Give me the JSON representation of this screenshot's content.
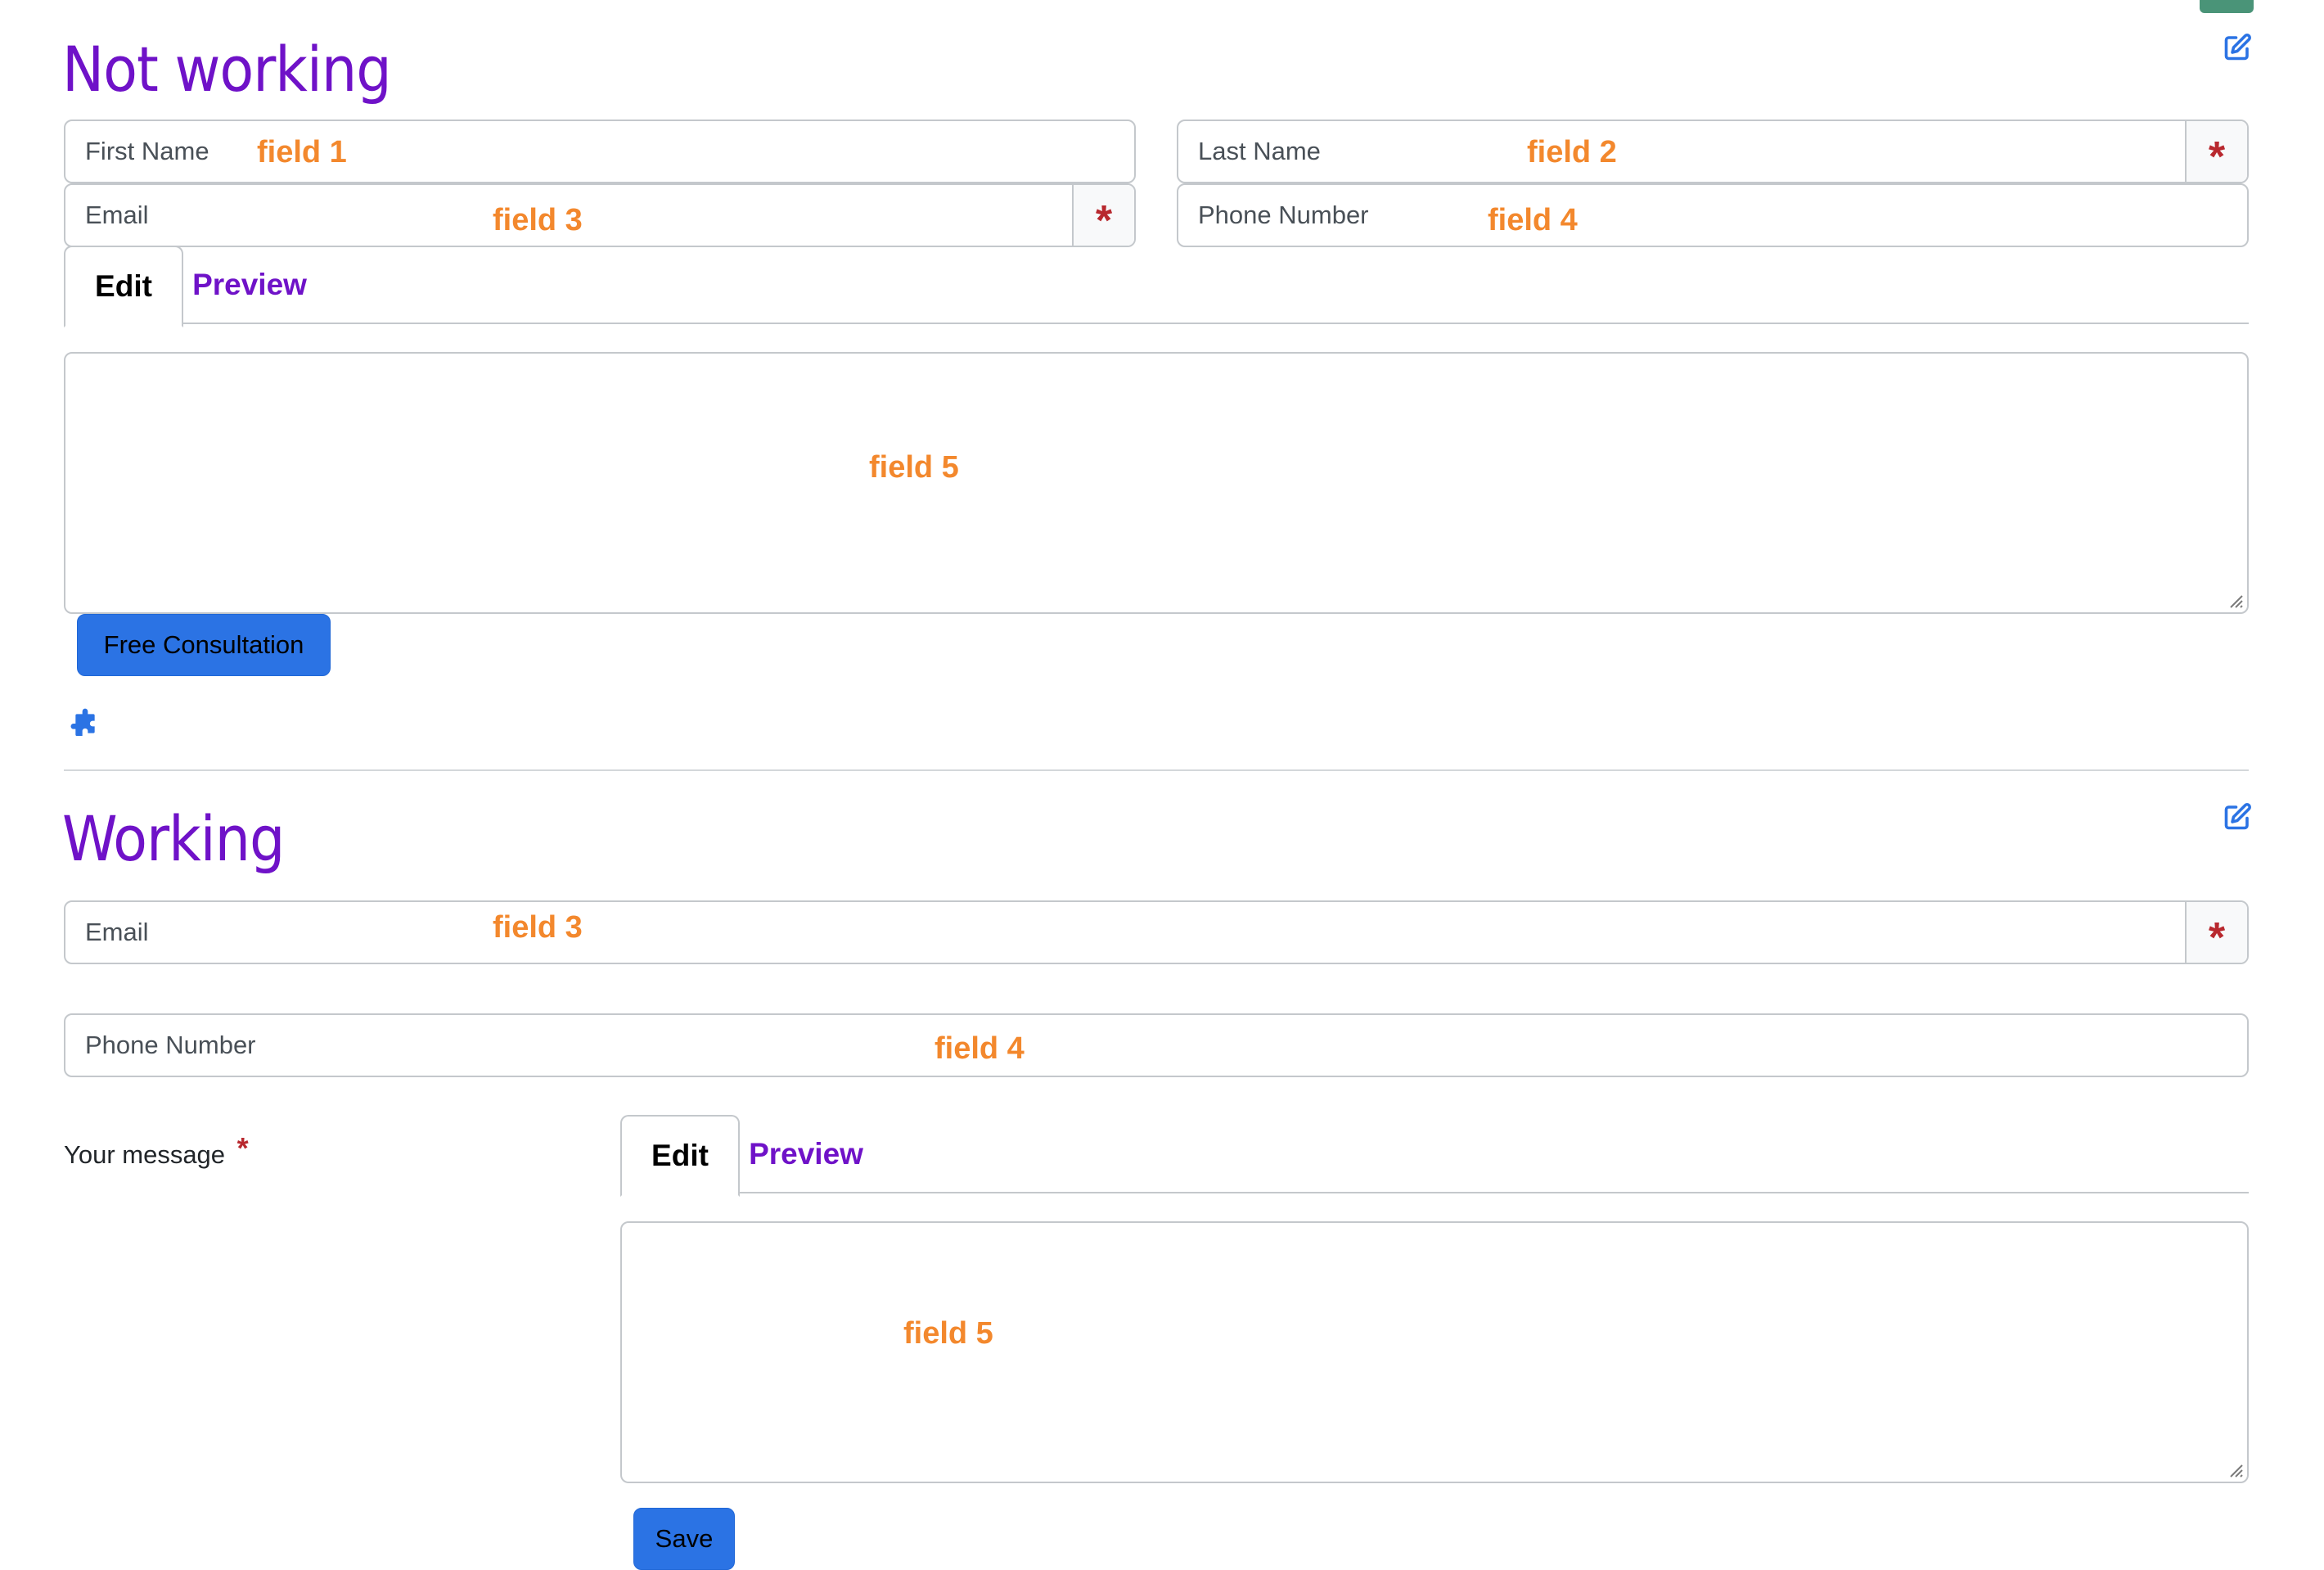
{
  "colors": {
    "heading": "#6f12c8",
    "annotation": "#f3882d",
    "button": "#2b73e4",
    "required": "#b8282e",
    "link": "#2b73e4",
    "corner_block": "#4a9478"
  },
  "icons": {
    "edit": "edit-icon",
    "puzzle": "puzzle-icon",
    "required": "asterisk-icon",
    "resize": "resize-grip-icon"
  },
  "section_not_working": {
    "title": "Not working",
    "first_name": {
      "placeholder": "First Name",
      "annotation": "field 1"
    },
    "last_name": {
      "placeholder": "Last Name",
      "annotation": "field 2",
      "required_mark": "*"
    },
    "email": {
      "placeholder": "Email",
      "annotation": "field 3",
      "required_mark": "*"
    },
    "phone": {
      "placeholder": "Phone Number",
      "annotation": "field 4"
    },
    "tabs": {
      "edit": "Edit",
      "preview": "Preview"
    },
    "message": {
      "annotation": "field 5"
    },
    "submit_label": "Free Consultation"
  },
  "section_working": {
    "title": "Working",
    "email": {
      "placeholder": "Email",
      "annotation": "field 3",
      "required_mark": "*"
    },
    "phone": {
      "placeholder": "Phone Number",
      "annotation": "field 4"
    },
    "message": {
      "label": "Your message",
      "required_mark": "*",
      "annotation": "field 5"
    },
    "tabs": {
      "edit": "Edit",
      "preview": "Preview"
    },
    "submit_label": "Save"
  }
}
